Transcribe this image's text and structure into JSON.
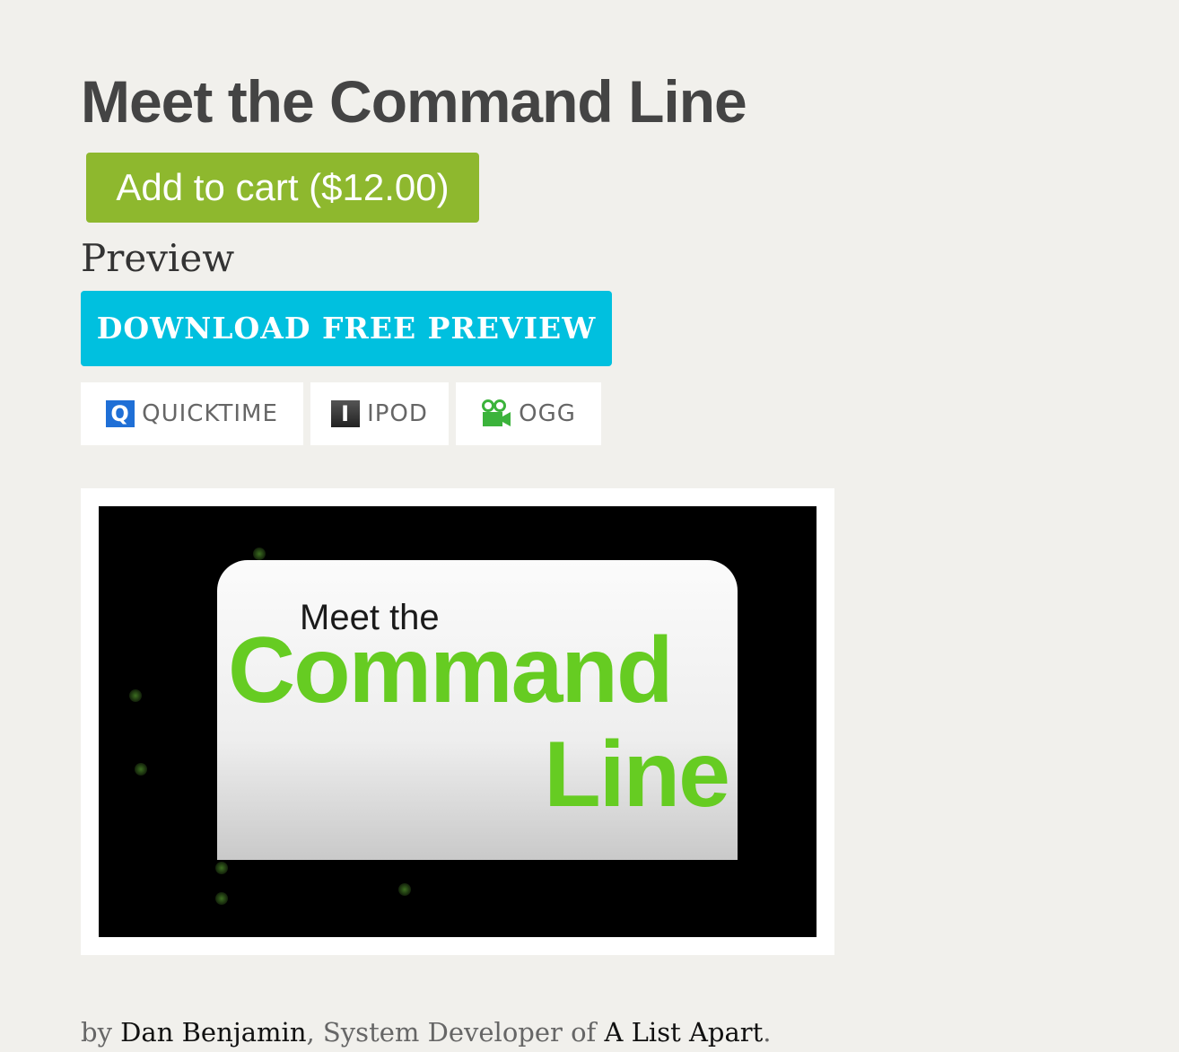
{
  "product": {
    "title": "Meet the Command Line",
    "cart_button_label": "Add to cart ($12.00)"
  },
  "preview": {
    "heading": "Preview",
    "download_button_label": "DOWNLOAD FREE PREVIEW",
    "formats": [
      {
        "label": "QUICKTIME",
        "icon": "quicktime-icon"
      },
      {
        "label": "IPOD",
        "icon": "ipod-icon"
      },
      {
        "label": "OGG",
        "icon": "video-camera-icon"
      }
    ],
    "icon_glyphs": {
      "quicktime": "Q",
      "ipod": "I"
    }
  },
  "video": {
    "meet_text": "Meet the",
    "command_text": "Command",
    "line_text": "Line"
  },
  "byline": {
    "prefix": "by",
    "author": "Dan Benjamin",
    "role_text": ", System Developer of",
    "publication": "A List Apart",
    "suffix": "."
  },
  "colors": {
    "background": "#f1f0ec",
    "cart_green": "#8eb82e",
    "download_cyan": "#00c0df",
    "video_green": "#66cc22"
  }
}
